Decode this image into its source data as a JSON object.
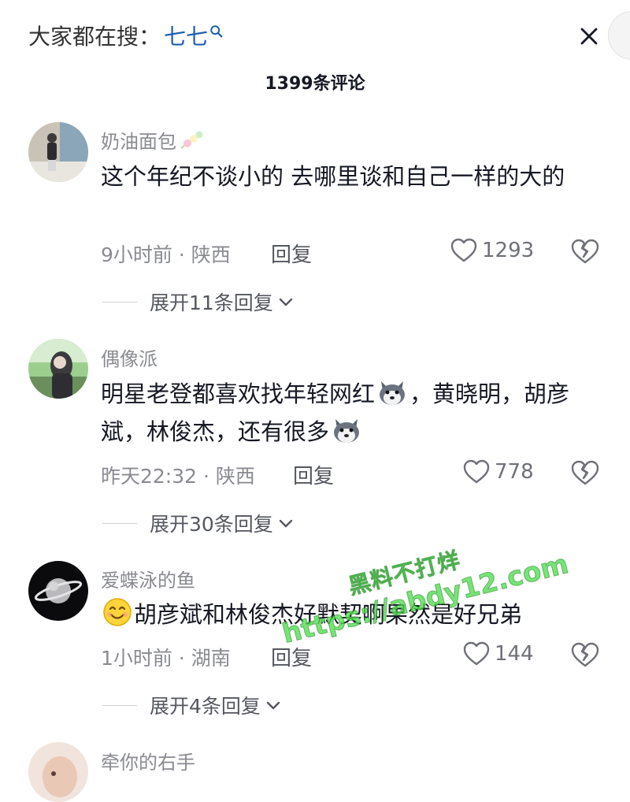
{
  "header": {
    "search_prefix": "大家都在搜：",
    "search_keyword": "七七",
    "comment_count_title": "1399条评论"
  },
  "comments": [
    {
      "username": "奶油面包",
      "text": "这个年纪不谈小的 去哪里谈和自己一样的大的",
      "time_location": "9小时前 · 陕西",
      "reply_label": "回复",
      "likes": "1293",
      "expand_label": "展开11条回复"
    },
    {
      "username": "偶像派",
      "text_before": "明星老登都喜欢找年轻网红",
      "text_middle": "，黄晓明，胡彦斌，林俊杰，还有很多",
      "time_location": "昨天22:32 · 陕西",
      "reply_label": "回复",
      "likes": "778",
      "expand_label": "展开30条回复"
    },
    {
      "username": "爱蝶泳的鱼",
      "text": "胡彦斌和林俊杰好默契啊果然是好兄弟",
      "time_location": "1小时前 · 湖南",
      "reply_label": "回复",
      "likes": "144",
      "expand_label": "展开4条回复"
    },
    {
      "username": "牵你的右手"
    }
  ],
  "watermark": {
    "line1": "黑料不打烊",
    "line2": "https://abdy12.com"
  },
  "icons": {
    "search": "search-icon",
    "close": "close-icon",
    "like": "heart-icon",
    "dislike": "broken-heart-icon",
    "expand": "chevron-down-icon"
  },
  "colors": {
    "keyword": "#1f5fae",
    "meta_gray": "#8a8b91",
    "text": "#161823"
  }
}
